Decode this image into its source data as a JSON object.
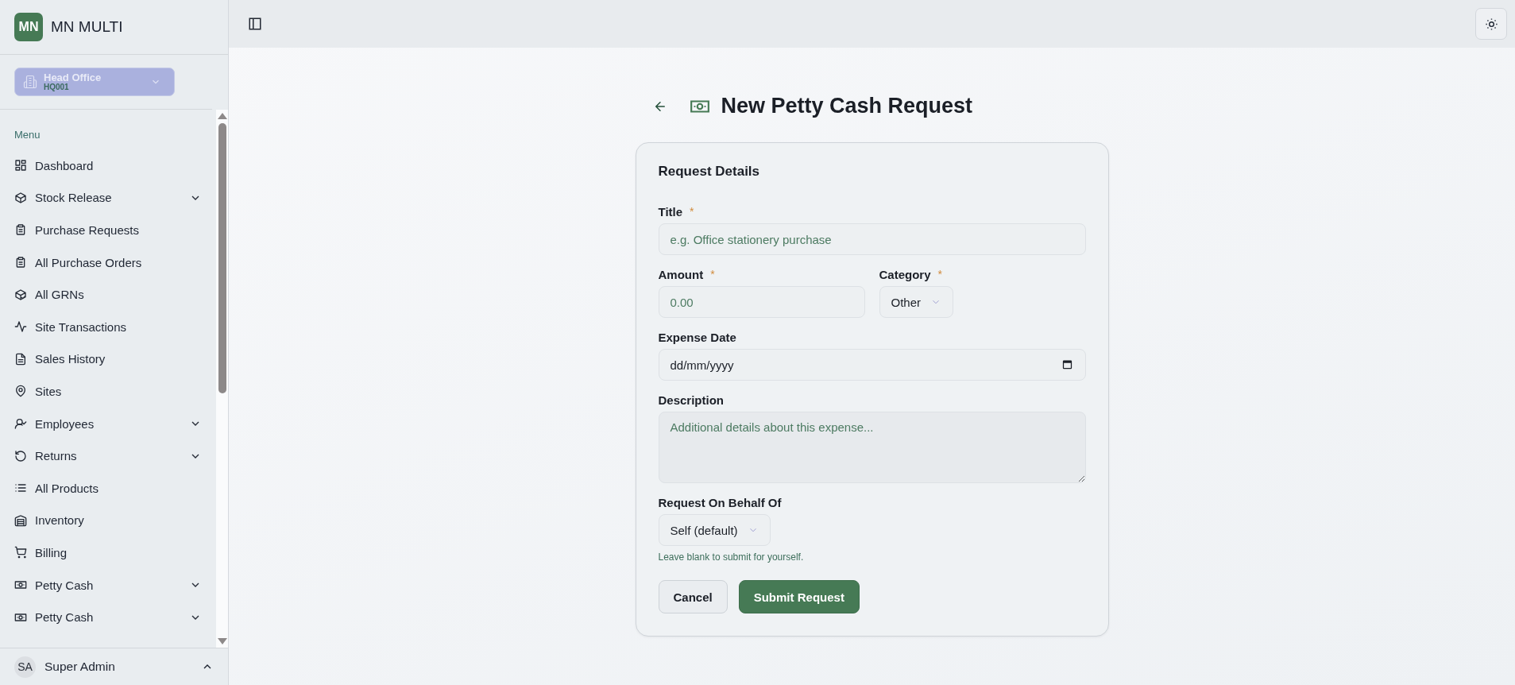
{
  "app": {
    "logo": "MN",
    "name": "MN MULTI"
  },
  "branch": {
    "name": "Head Office",
    "code": "HQ001"
  },
  "menu": {
    "heading": "Menu",
    "items": [
      {
        "label": "Dashboard",
        "expandable": false
      },
      {
        "label": "Stock Release",
        "expandable": true
      },
      {
        "label": "Purchase Requests",
        "expandable": false
      },
      {
        "label": "All Purchase Orders",
        "expandable": false
      },
      {
        "label": "All GRNs",
        "expandable": false
      },
      {
        "label": "Site Transactions",
        "expandable": false
      },
      {
        "label": "Sales History",
        "expandable": false
      },
      {
        "label": "Sites",
        "expandable": false
      },
      {
        "label": "Employees",
        "expandable": true
      },
      {
        "label": "Returns",
        "expandable": true
      },
      {
        "label": "All Products",
        "expandable": false
      },
      {
        "label": "Inventory",
        "expandable": false
      },
      {
        "label": "Billing",
        "expandable": false
      },
      {
        "label": "Petty Cash",
        "expandable": true
      },
      {
        "label": "Petty Cash",
        "expandable": true
      }
    ]
  },
  "user": {
    "initials": "SA",
    "name": "Super Admin"
  },
  "page": {
    "title": "New Petty Cash Request"
  },
  "form": {
    "heading": "Request Details",
    "title": {
      "label": "Title",
      "required_mark": "*",
      "placeholder": "e.g. Office stationery purchase"
    },
    "amount": {
      "label": "Amount",
      "required_mark": "*",
      "placeholder": "0.00"
    },
    "category": {
      "label": "Category",
      "required_mark": "*",
      "value": "Other"
    },
    "expense_date": {
      "label": "Expense Date",
      "placeholder": "dd/mm/yyyy"
    },
    "description": {
      "label": "Description",
      "placeholder": "Additional details about this expense..."
    },
    "behalf": {
      "label": "Request On Behalf Of",
      "value": "Self (default)",
      "hint": "Leave blank to submit for yourself."
    },
    "buttons": {
      "cancel": "Cancel",
      "submit": "Submit Request"
    }
  }
}
